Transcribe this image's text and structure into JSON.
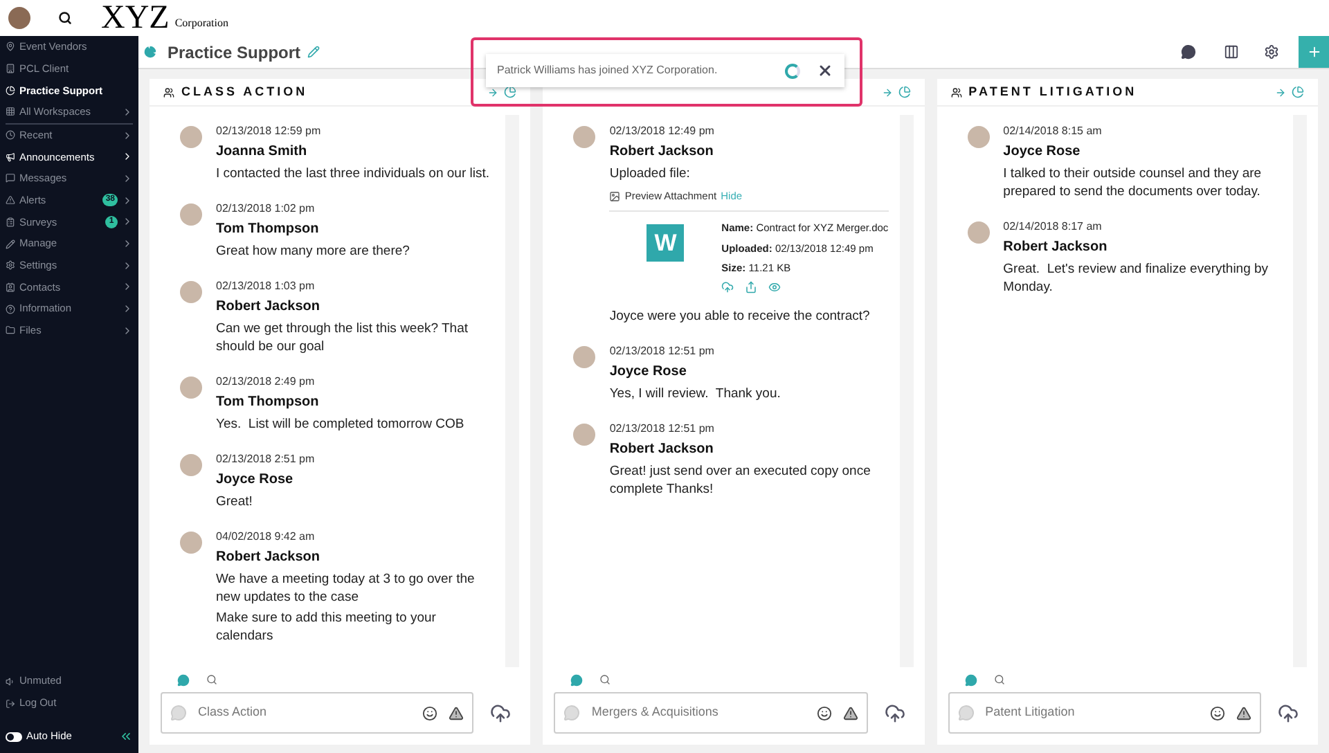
{
  "topbar": {
    "logo": "XYZ",
    "logo_sub": "Corporation"
  },
  "sidebar": {
    "items": [
      {
        "label": "Event Vendors",
        "selected": false,
        "highlighted": false,
        "chevron": false
      },
      {
        "label": "PCL Client",
        "selected": false,
        "highlighted": false,
        "chevron": false
      },
      {
        "label": "Practice Support",
        "selected": true,
        "highlighted": true,
        "chevron": false
      },
      {
        "label": "All Workspaces",
        "selected": false,
        "highlighted": false,
        "chevron": true
      },
      {
        "label": "Recent",
        "selected": false,
        "highlighted": false,
        "chevron": true
      },
      {
        "label": "Announcements",
        "selected": false,
        "highlighted": true,
        "chevron": true
      },
      {
        "label": "Messages",
        "selected": false,
        "highlighted": false,
        "chevron": true
      },
      {
        "label": "Alerts",
        "selected": false,
        "highlighted": false,
        "chevron": true,
        "badge": "38"
      },
      {
        "label": "Surveys",
        "selected": false,
        "highlighted": false,
        "chevron": true,
        "badge": "1"
      },
      {
        "label": "Manage",
        "selected": false,
        "highlighted": false,
        "chevron": true
      },
      {
        "label": "Settings",
        "selected": false,
        "highlighted": false,
        "chevron": true
      },
      {
        "label": "Contacts",
        "selected": false,
        "highlighted": false,
        "chevron": true
      },
      {
        "label": "Information",
        "selected": false,
        "highlighted": false,
        "chevron": true
      },
      {
        "label": "Files",
        "selected": false,
        "highlighted": false,
        "chevron": true
      }
    ],
    "footer": {
      "unmuted": "Unmuted",
      "logout": "Log Out",
      "auto_hide": {
        "label": "Auto Hide",
        "on": false
      }
    }
  },
  "header": {
    "title": "Practice Support"
  },
  "toast": {
    "message": "Patrick Williams has joined XYZ Corporation."
  },
  "columns": [
    {
      "title": "CLASS ACTION",
      "placeholder": "Class Action",
      "messages": [
        {
          "time": "02/13/2018 12:59 pm",
          "author": "Joanna Smith",
          "paragraphs": [
            "I contacted the last three individuals on our list."
          ]
        },
        {
          "time": "02/13/2018 1:02 pm",
          "author": "Tom Thompson",
          "paragraphs": [
            "Great how many more are there?"
          ]
        },
        {
          "time": "02/13/2018 1:03 pm",
          "author": "Robert Jackson",
          "paragraphs": [
            "Can we get through the list this week? That should be our goal"
          ]
        },
        {
          "time": "02/13/2018 2:49 pm",
          "author": "Tom Thompson",
          "paragraphs": [
            "Yes.  List will be completed tomorrow COB"
          ]
        },
        {
          "time": "02/13/2018 2:51 pm",
          "author": "Joyce Rose",
          "paragraphs": [
            "Great!"
          ]
        },
        {
          "time": "04/02/2018 9:42 am",
          "author": "Robert Jackson",
          "paragraphs": [
            "We have a meeting today at 3 to go over the new updates to the case",
            "Make sure to add this meeting to your calendars"
          ]
        }
      ]
    },
    {
      "placeholder": "Mergers & Acquisitions",
      "messages": [
        {
          "time": "02/13/2018 12:49 pm",
          "author": "Robert Jackson",
          "paragraphs": [
            "Uploaded file:"
          ],
          "attachment": {
            "preview": "Preview Attachment",
            "hide": "Hide",
            "letter": "W",
            "fields": [
              {
                "label": "Name:",
                "value": "Contract for XYZ Merger.doc"
              },
              {
                "label": "Uploaded:",
                "value": "02/13/2018 12:49 pm"
              },
              {
                "label": "Size:",
                "value": "11.21 KB"
              }
            ]
          },
          "after": "Joyce were you able to receive the contract?"
        },
        {
          "time": "02/13/2018 12:51 pm",
          "author": "Joyce Rose",
          "paragraphs": [
            "Yes, I will review.  Thank you."
          ]
        },
        {
          "time": "02/13/2018 12:51 pm",
          "author": "Robert Jackson",
          "paragraphs": [
            "Great! just send over an executed copy once complete Thanks!"
          ]
        }
      ]
    },
    {
      "title": "PATENT LITIGATION",
      "placeholder": "Patent Litigation",
      "messages": [
        {
          "time": "02/14/2018 8:15 am",
          "author": "Joyce Rose",
          "paragraphs": [
            "I talked to their outside counsel and they are prepared to send the documents over today."
          ]
        },
        {
          "time": "02/14/2018 8:17 am",
          "author": "Robert Jackson",
          "paragraphs": [
            "Great.  Let's review and finalize everything by Monday."
          ]
        }
      ]
    }
  ]
}
